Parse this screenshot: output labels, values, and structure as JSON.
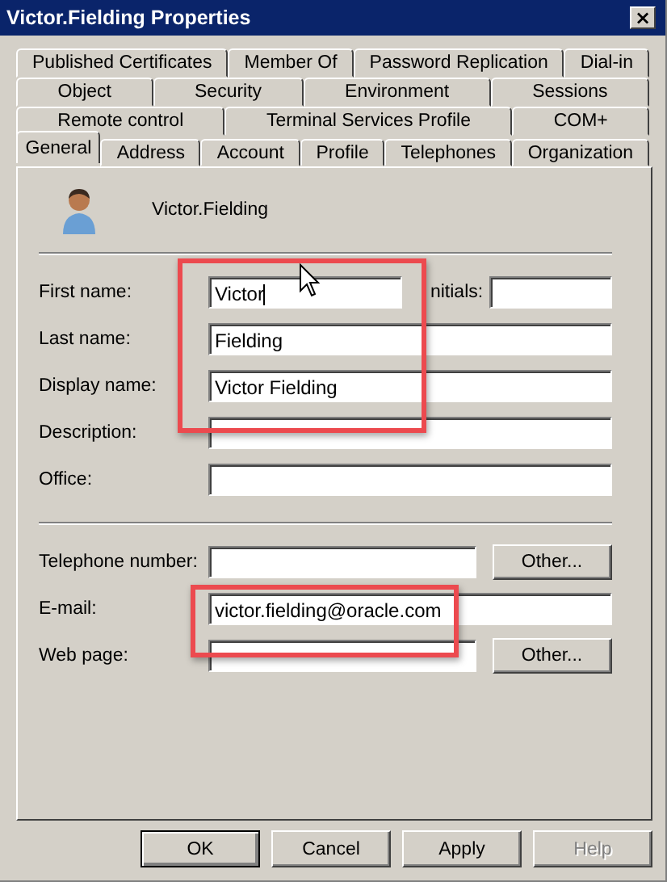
{
  "window": {
    "title": "Victor.Fielding Properties",
    "close": "×"
  },
  "tab_rows": [
    [
      {
        "label": "Published Certificates",
        "selected": false
      },
      {
        "label": "Member Of",
        "selected": false
      },
      {
        "label": "Password Replication",
        "selected": false
      },
      {
        "label": "Dial-in",
        "selected": false
      }
    ],
    [
      {
        "label": "Object",
        "selected": false
      },
      {
        "label": "Security",
        "selected": false
      },
      {
        "label": "Environment",
        "selected": false
      },
      {
        "label": "Sessions",
        "selected": false
      }
    ],
    [
      {
        "label": "Remote control",
        "selected": false
      },
      {
        "label": "Terminal Services Profile",
        "selected": false
      },
      {
        "label": "COM+",
        "selected": false
      }
    ],
    [
      {
        "label": "General",
        "selected": true
      },
      {
        "label": "Address",
        "selected": false
      },
      {
        "label": "Account",
        "selected": false
      },
      {
        "label": "Profile",
        "selected": false
      },
      {
        "label": "Telephones",
        "selected": false
      },
      {
        "label": "Organization",
        "selected": false
      }
    ]
  ],
  "user": {
    "name": "Victor.Fielding"
  },
  "name_fields": [
    {
      "kind": "pair",
      "label": "First name:",
      "value": "Victor",
      "second_label": "nitials:"
    },
    {
      "kind": "wide",
      "label": "Last name:",
      "value": "Fielding"
    },
    {
      "kind": "wide",
      "label": "Display name:",
      "value": "Victor Fielding"
    },
    {
      "kind": "wide",
      "label": "Description:"
    },
    {
      "kind": "wide",
      "label": "Office:"
    }
  ],
  "contact_fields": [
    {
      "kind": "button",
      "label": "Telephone number:",
      "button": "Other..."
    },
    {
      "kind": "wide",
      "label": "E-mail:",
      "value": "victor.fielding@oracle.com"
    },
    {
      "kind": "button",
      "label": "Web page:",
      "button": "Other..."
    }
  ],
  "buttons": [
    {
      "label": "OK",
      "default": true,
      "disabled": false
    },
    {
      "label": "Cancel",
      "default": false,
      "disabled": false
    },
    {
      "label": "Apply",
      "default": false,
      "disabled": false
    },
    {
      "label": "Help",
      "default": false,
      "disabled": true
    }
  ]
}
